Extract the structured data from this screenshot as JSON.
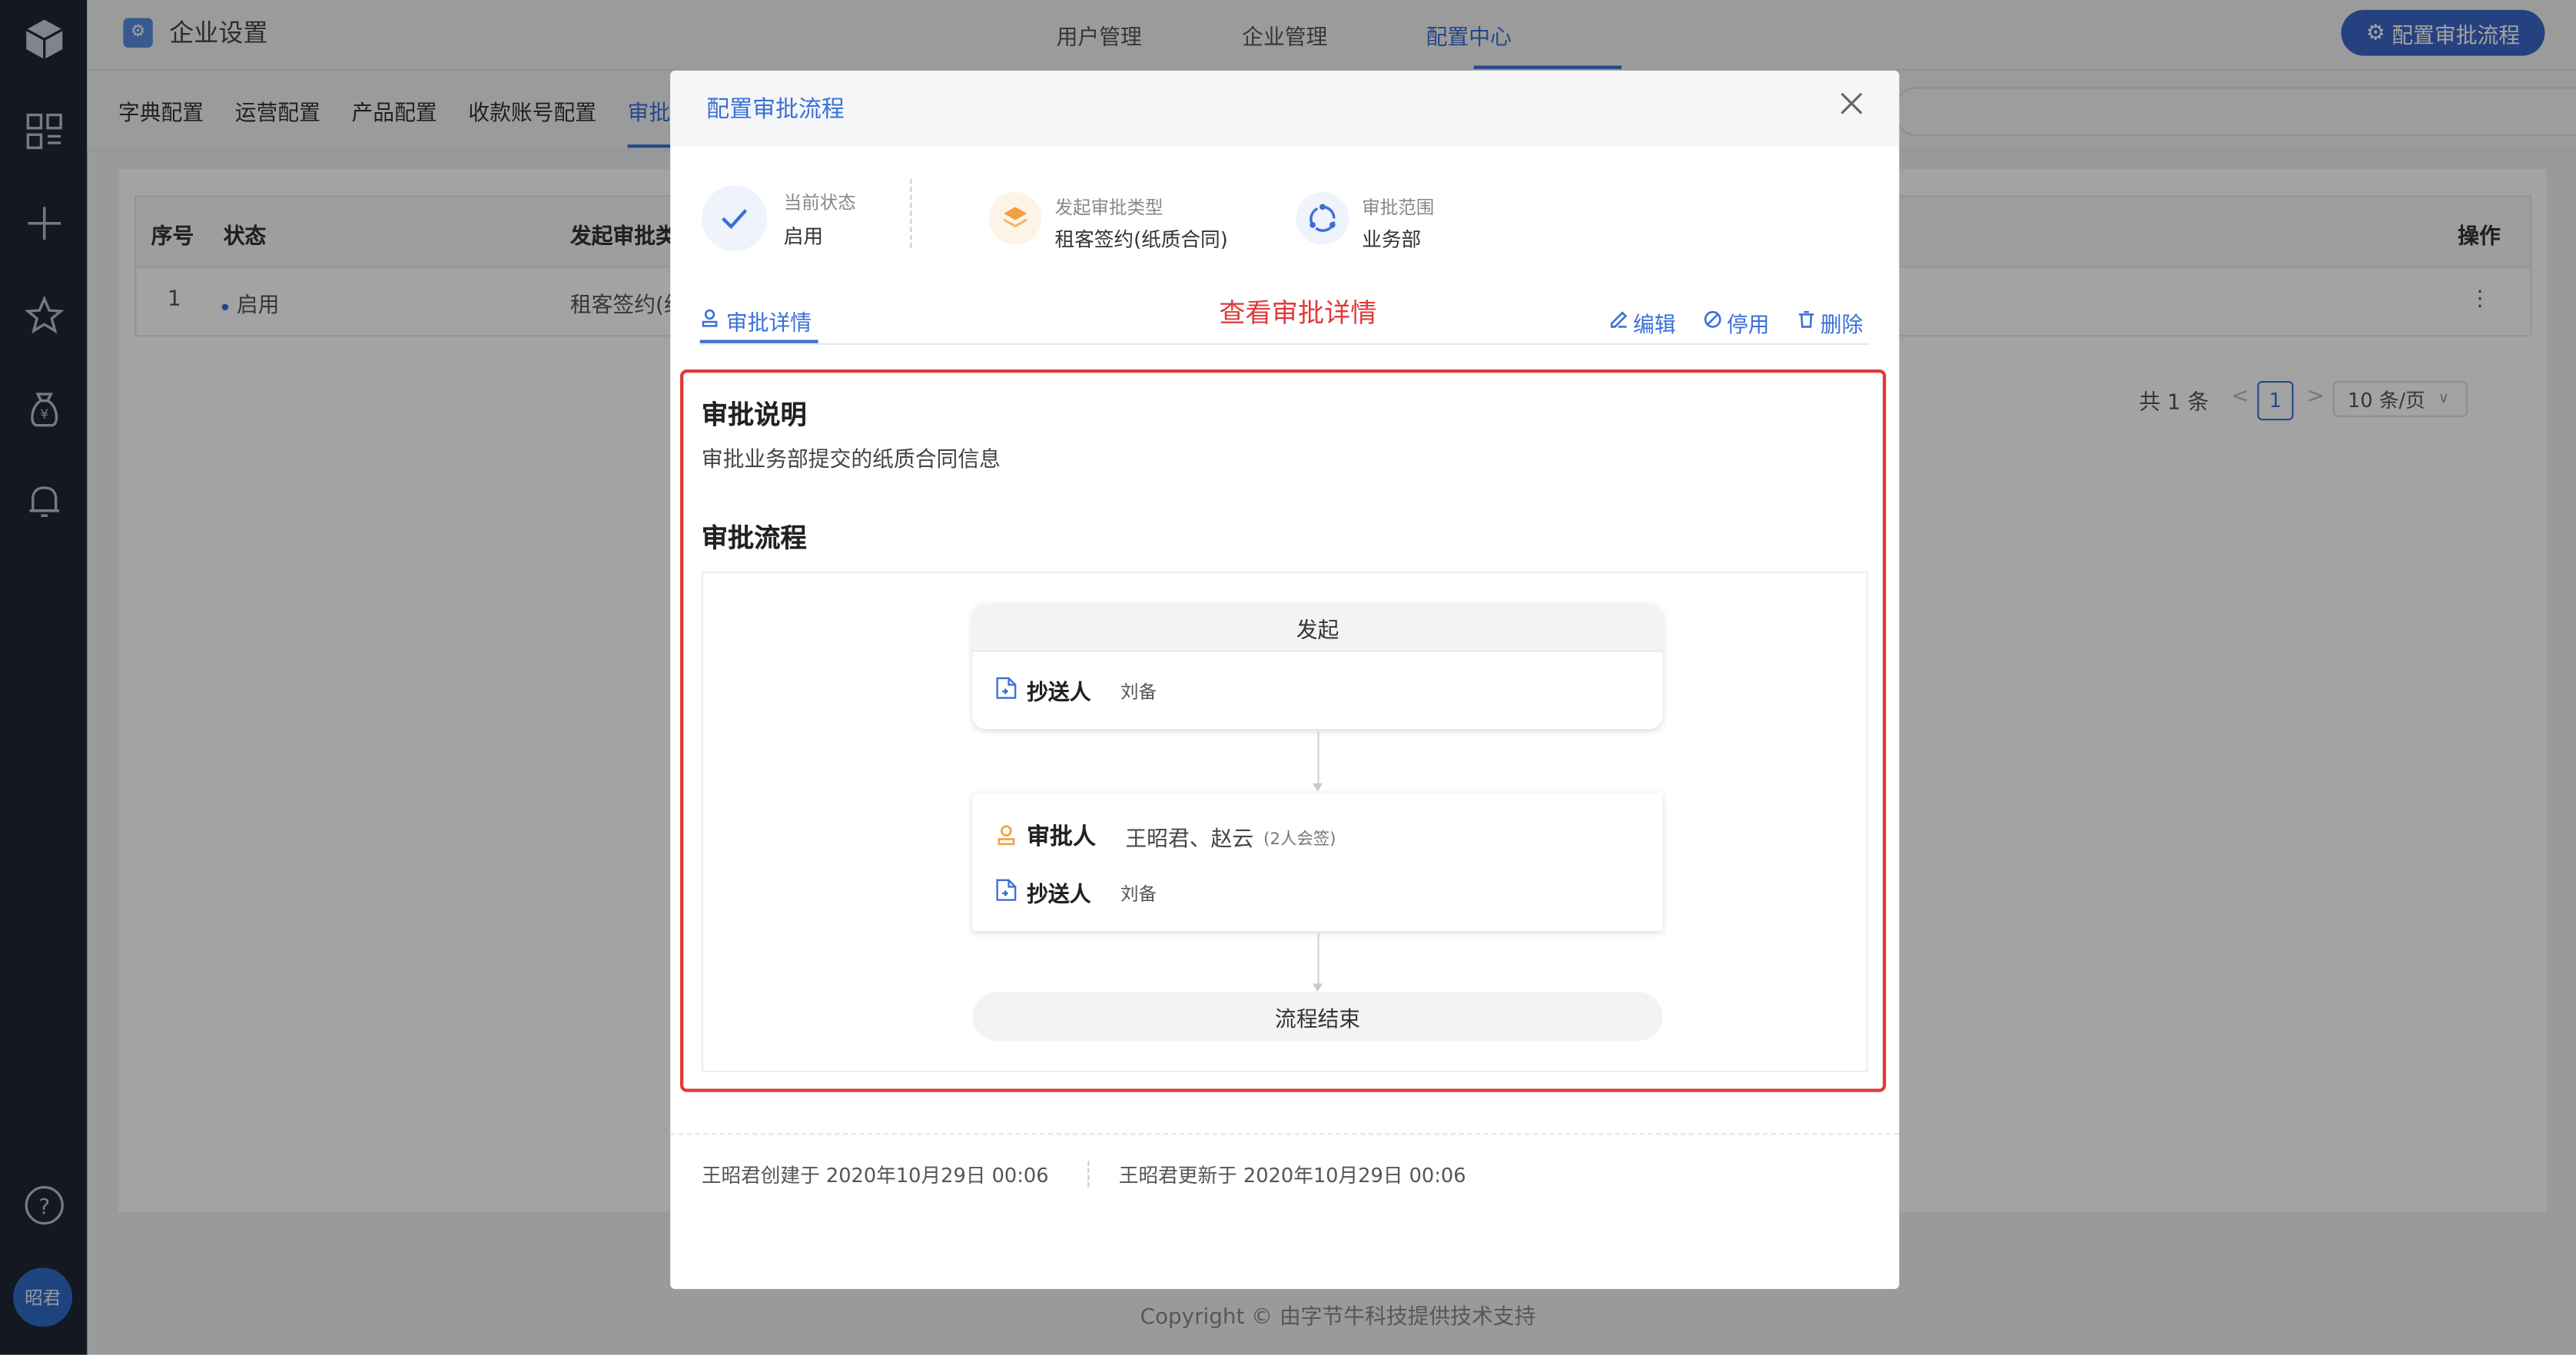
{
  "app": {
    "brand": "企业设置",
    "top_nav": [
      "用户管理",
      "企业管理",
      "配置中心"
    ],
    "active_top_nav": "配置中心",
    "top_button": "配置审批流程",
    "user_avatar": "昭君"
  },
  "sub_tabs": [
    "字典配置",
    "运营配置",
    "产品配置",
    "收款账号配置",
    "审批"
  ],
  "table": {
    "headers": [
      "序号",
      "状态",
      "发起审批类",
      "操作"
    ],
    "rows": [
      {
        "index": "1",
        "status": "启用",
        "type": "租客签约(纸"
      }
    ]
  },
  "pagination": {
    "total": "共 1 条",
    "prev": "<",
    "current": "1",
    "next": ">",
    "page_size": "10 条/页"
  },
  "copyright": "Copyright © 由字节牛科技提供技术支持",
  "modal": {
    "title": "配置审批流程",
    "status": {
      "current_label": "当前状态",
      "current_value": "启用",
      "type_label": "发起审批类型",
      "type_value": "租客签约(纸质合同)",
      "scope_label": "审批范围",
      "scope_value": "业务部"
    },
    "tab": "审批详情",
    "annotation": "查看审批详情",
    "actions": {
      "edit": "编辑",
      "disable": "停用",
      "delete": "删除"
    },
    "description_title": "审批说明",
    "description": "审批业务部提交的纸质合同信息",
    "flow_title": "审批流程",
    "flow": {
      "start_label": "发起",
      "start_cc_role": "抄送人",
      "start_cc_name": "刘备",
      "approver_role": "审批人",
      "approver_names": "王昭君、赵云",
      "approver_note": "(2人会签)",
      "cc_role": "抄送人",
      "cc_name": "刘备",
      "end_label": "流程结束"
    },
    "footer": {
      "created": "王昭君创建于 2020年10月29日 00:06",
      "updated": "王昭君更新于 2020年10月29日 00:06"
    }
  },
  "colors": {
    "accent": "#3a6fd6",
    "annotation": "#e03a3a",
    "nav_bg": "#1f2735"
  }
}
